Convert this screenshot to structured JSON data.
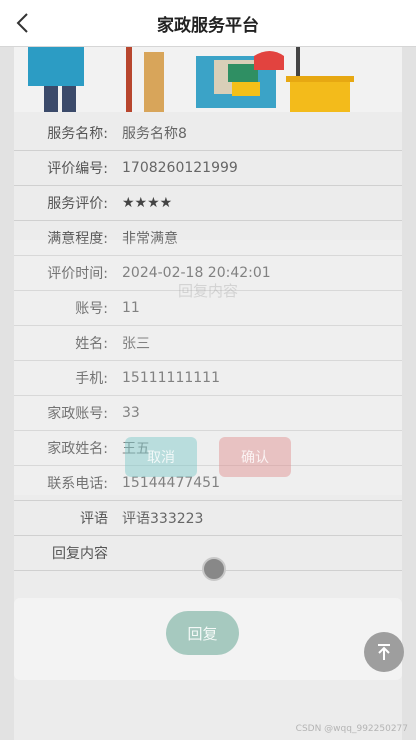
{
  "header": {
    "title": "家政服务平台",
    "back_icon": "chevron-left-icon"
  },
  "details": [
    {
      "label": "服务名称:",
      "value": "服务名称8"
    },
    {
      "label": "评价编号:",
      "value": "1708260121999"
    },
    {
      "label": "服务评价:",
      "value": "★★★★"
    },
    {
      "label": "满意程度:",
      "value": "非常满意"
    },
    {
      "label": "评价时间:",
      "value": "2024-02-18 20:42:01"
    },
    {
      "label": "账号:",
      "value": "11"
    },
    {
      "label": "姓名:",
      "value": "张三"
    },
    {
      "label": "手机:",
      "value": "15111111111"
    },
    {
      "label": "家政账号:",
      "value": "33"
    },
    {
      "label": "家政姓名:",
      "value": "王五"
    },
    {
      "label": "联系电话:",
      "value": "15144477451"
    },
    {
      "label": "评语",
      "value": "评语333223"
    },
    {
      "label": "回复内容",
      "value": ""
    }
  ],
  "modal": {
    "title": "回复内容",
    "cancel_label": "取消",
    "confirm_label": "确认"
  },
  "reply": {
    "button_label": "回复"
  },
  "back_to_top_icon": "arrow-up-to-top-icon",
  "watermark": "CSDN @wqq_992250277"
}
